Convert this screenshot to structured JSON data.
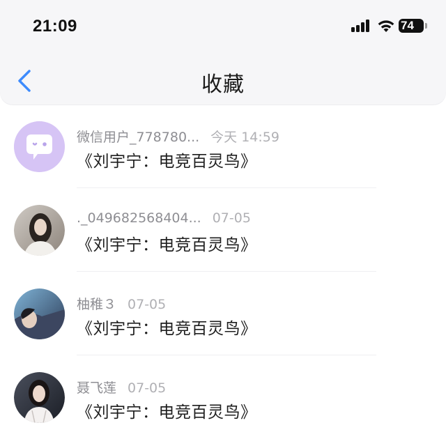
{
  "status_bar": {
    "time": "21:09",
    "battery": "74"
  },
  "nav": {
    "title": "收藏",
    "back_icon": "chevron-left-icon",
    "accent_color": "#3d8bfd"
  },
  "items": [
    {
      "name": "微信用户_778780...",
      "date": "今天 14:59",
      "content": "《刘宇宁：电竞百灵鸟》",
      "avatar": "wechat-default-avatar"
    },
    {
      "name": "._049682568404...",
      "date": "07-05",
      "content": "《刘宇宁：电竞百灵鸟》",
      "avatar": "photo-avatar"
    },
    {
      "name": "柚稚３",
      "date": "07-05",
      "content": "《刘宇宁：电竞百灵鸟》",
      "avatar": "photo-avatar"
    },
    {
      "name": "聂飞莲",
      "date": "07-05",
      "content": "《刘宇宁：电竞百灵鸟》",
      "avatar": "photo-avatar"
    }
  ]
}
